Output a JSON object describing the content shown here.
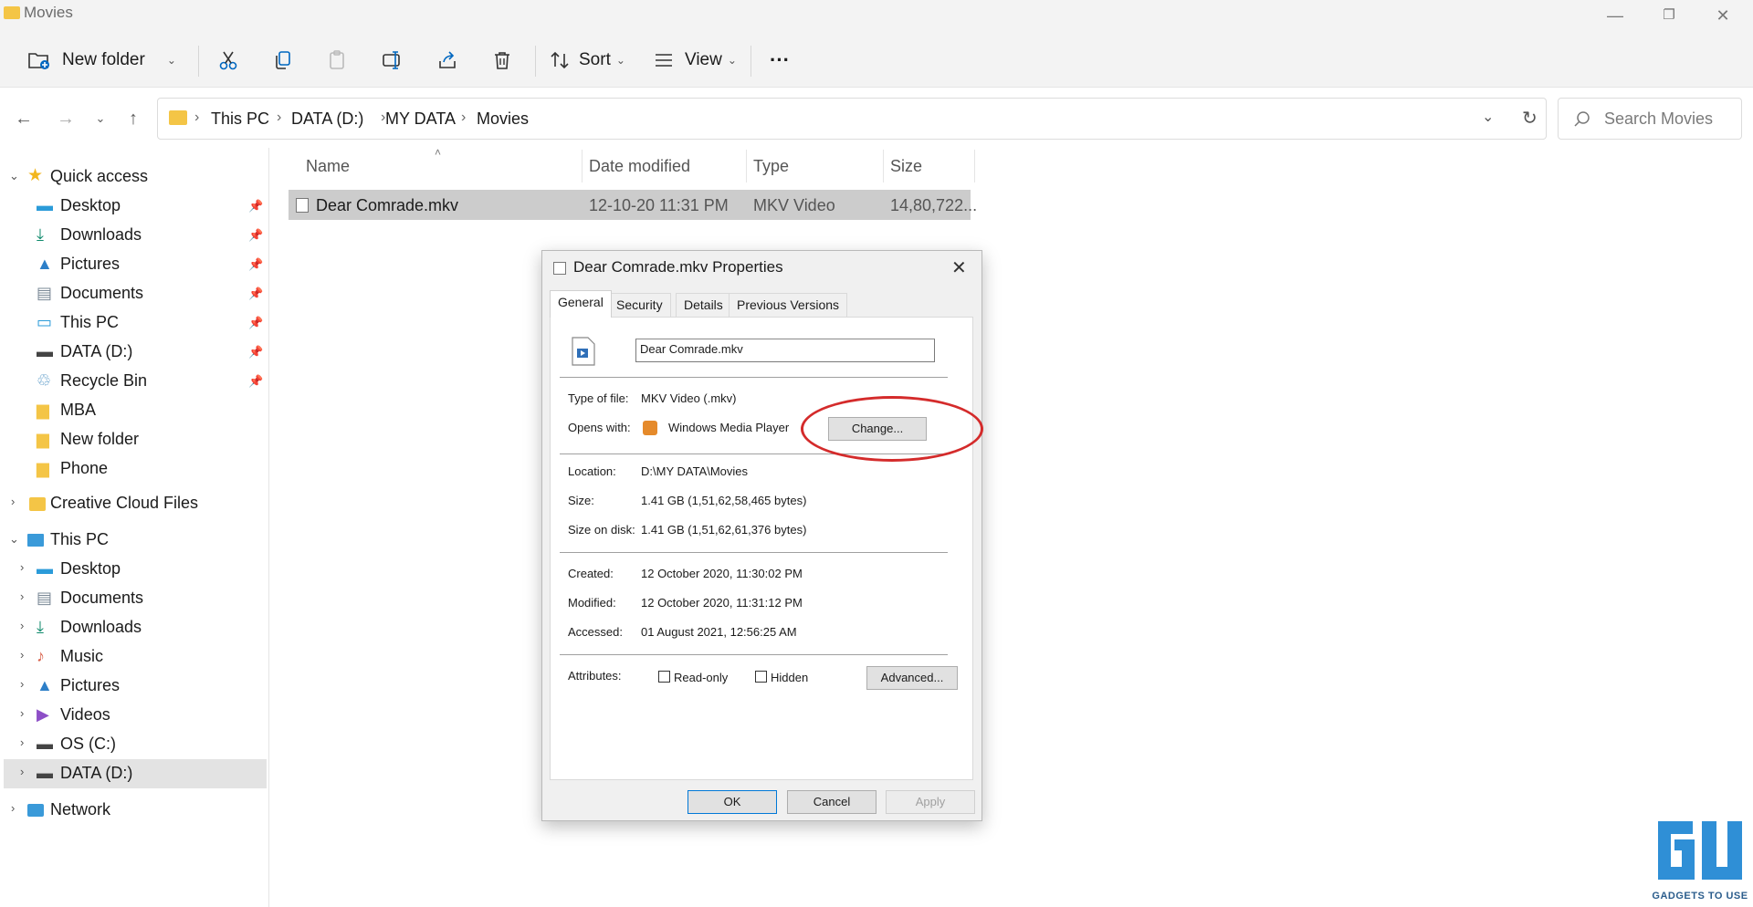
{
  "window": {
    "title": "Movies"
  },
  "toolbar": {
    "new_folder_label": "New folder",
    "sort_label": "Sort",
    "view_label": "View",
    "more_label": "···"
  },
  "address": {
    "crumbs": [
      "This PC",
      "DATA (D:)",
      "MY DATA",
      "Movies"
    ],
    "search_placeholder": "Search Movies"
  },
  "sidebar": {
    "quick_access": "Quick access",
    "quick_items": [
      "Desktop",
      "Downloads",
      "Pictures",
      "Documents",
      "This PC",
      "DATA (D:)",
      "Recycle Bin",
      "MBA",
      "New folder",
      "Phone"
    ],
    "creative_cloud": "Creative Cloud Files",
    "this_pc": "This PC",
    "pc_items": [
      "Desktop",
      "Documents",
      "Downloads",
      "Music",
      "Pictures",
      "Videos",
      "OS (C:)",
      "DATA (D:)"
    ],
    "network": "Network"
  },
  "filelist": {
    "columns": [
      "Name",
      "Date modified",
      "Type",
      "Size"
    ],
    "rows": [
      {
        "name": "Dear Comrade.mkv",
        "date": "12-10-20 11:31 PM",
        "type": "MKV Video",
        "size": "14,80,722..."
      }
    ]
  },
  "dialog": {
    "title": "Dear Comrade.mkv Properties",
    "tabs": [
      "General",
      "Security",
      "Details",
      "Previous Versions"
    ],
    "filename": "Dear Comrade.mkv",
    "type_label": "Type of file:",
    "type_value": "MKV Video (.mkv)",
    "opens_label": "Opens with:",
    "opens_value": "Windows Media Player",
    "change_label": "Change...",
    "location_label": "Location:",
    "location_value": "D:\\MY DATA\\Movies",
    "size_label": "Size:",
    "size_value": "1.41 GB (1,51,62,58,465 bytes)",
    "sod_label": "Size on disk:",
    "sod_value": "1.41 GB (1,51,62,61,376 bytes)",
    "created_label": "Created:",
    "created_value": "12 October 2020, 11:30:02 PM",
    "modified_label": "Modified:",
    "modified_value": "12 October 2020, 11:31:12 PM",
    "accessed_label": "Accessed:",
    "accessed_value": "01 August 2021, 12:56:25 AM",
    "attributes_label": "Attributes:",
    "readonly_label": "Read-only",
    "hidden_label": "Hidden",
    "advanced_label": "Advanced...",
    "ok_label": "OK",
    "cancel_label": "Cancel",
    "apply_label": "Apply"
  },
  "watermark": {
    "text": "GADGETS TO USE"
  }
}
